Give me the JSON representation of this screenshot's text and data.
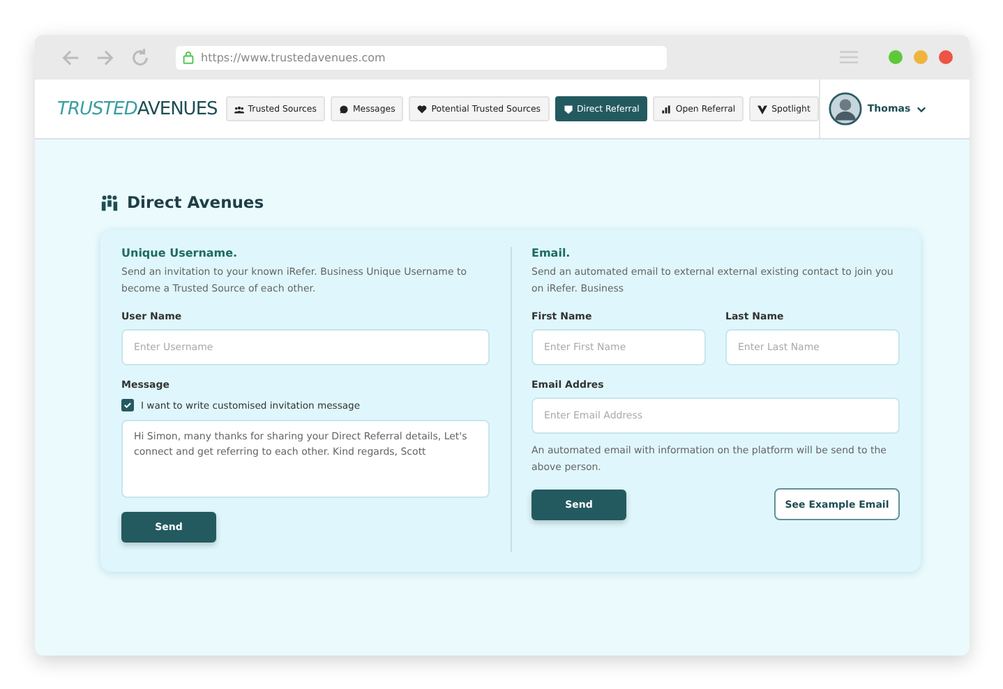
{
  "browser": {
    "url": "https://www.trustedavenues.com"
  },
  "header": {
    "logo": {
      "first": "TRUSTED",
      "second": "AVENUES"
    },
    "tabs": [
      {
        "label": "Trusted Sources",
        "selected": false
      },
      {
        "label": "Messages",
        "selected": false
      },
      {
        "label": "Potential Trusted Sources",
        "selected": false
      },
      {
        "label": "Direct Referral",
        "selected": true
      },
      {
        "label": "Open Referral",
        "selected": false
      },
      {
        "label": "Spotlight",
        "selected": false
      }
    ],
    "user": {
      "name": "Thomas"
    }
  },
  "page": {
    "title": "Direct Avenues",
    "left": {
      "heading": "Unique Username.",
      "description": "Send an invitation to your known iRefer. Business Unique Username to become a Trusted Source of each other.",
      "username": {
        "label": "User Name",
        "placeholder": "Enter Username"
      },
      "message_label": "Message",
      "custom_message": {
        "label": "I want to write customised invitation message",
        "checked": true
      },
      "message": "Hi Simon, many thanks for sharing your Direct Referral details, Let's connect and get referring to each other. Kind regards, Scott",
      "send": "Send"
    },
    "right": {
      "heading": "Email.",
      "description": "Send an automated email to external external existing contact to join you on iRefer. Business",
      "first_name": {
        "label": "First Name",
        "placeholder": "Enter First Name"
      },
      "last_name": {
        "label": "Last Name",
        "placeholder": "Enter Last Name"
      },
      "email": {
        "label": "Email Addres",
        "placeholder": "Enter Email Address"
      },
      "note": "An automated email with information on the platform will be send to the above person.",
      "send": "Send",
      "example": "See Example Email"
    }
  }
}
